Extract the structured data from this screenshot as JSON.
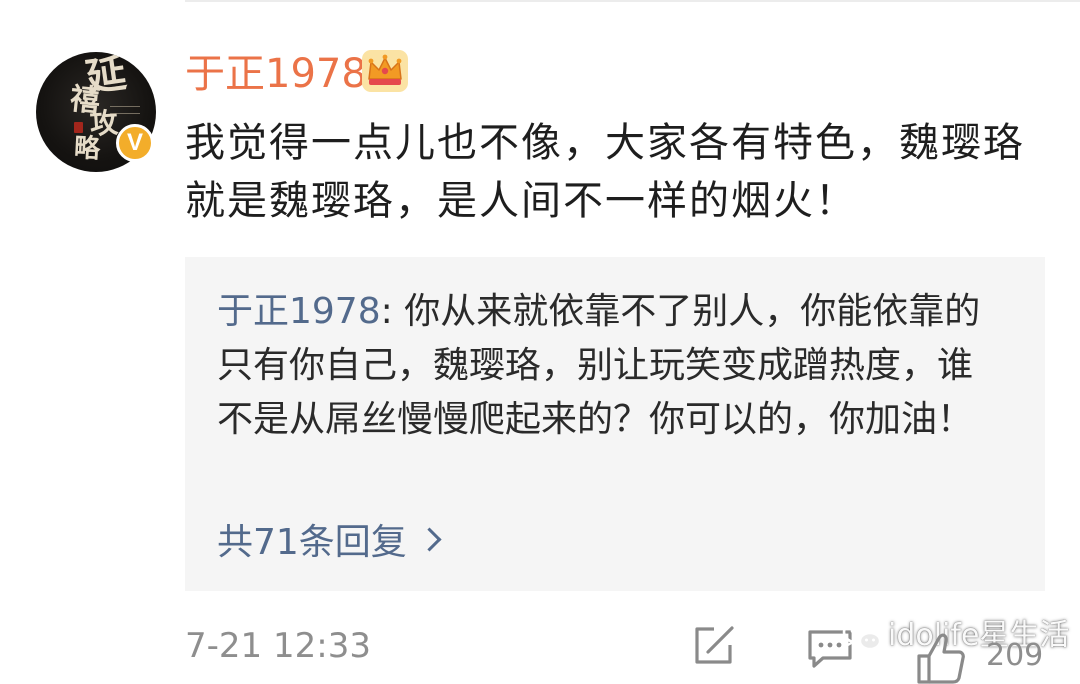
{
  "post": {
    "author": "于正1978",
    "verified_badge": "V",
    "content": "我觉得一点儿也不像，大家各有特色，魏璎珞就是魏璎珞，是人间不一样的烟火！",
    "quoted_reply": {
      "author": "于正1978",
      "separator": ": ",
      "text": "你从来就依靠不了别人，你能依靠的只有你自己，魏璎珞，别让玩笑变成蹭热度，谁不是从屌丝慢慢爬起来的？你可以的，你加油！"
    },
    "replies_link": "共71条回复",
    "timestamp": "7-21 12:33",
    "like_count": "209"
  },
  "avatar": {
    "lettering": [
      "延",
      "禧",
      "攻",
      "略"
    ]
  },
  "watermark": {
    "text": "idolife星生活"
  },
  "icons": {
    "crown": "crown-icon",
    "verify": "verified-v-icon",
    "chevron": "chevron-right-icon",
    "repost": "repost-icon",
    "comment": "comment-icon",
    "like": "like-icon",
    "watermark_logo": "wechat-logo-icon"
  },
  "colors": {
    "username": "#eb7348",
    "link": "#536a8c",
    "text": "#1e1e1e",
    "muted": "#8e8e8e",
    "quote_bg": "#f5f5f5",
    "badge": "#f3ad2a"
  }
}
